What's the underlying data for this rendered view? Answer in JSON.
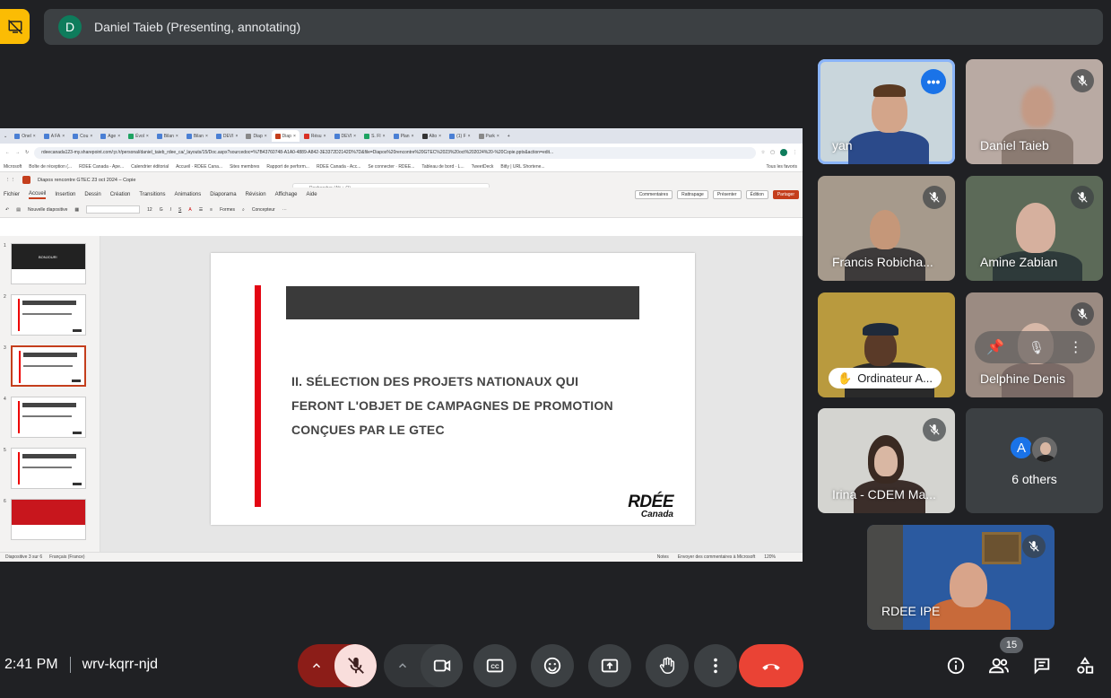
{
  "presenter_bar": {
    "avatar_letter": "D",
    "text": "Daniel Taieb (Presenting, annotating)"
  },
  "shared_screen": {
    "browser_tabs": [
      "Onel",
      "A FA",
      "Cou",
      "Age",
      "Évol",
      "Bilan",
      "Bilan",
      "DEVI",
      "Diap",
      "Diap",
      "Résu",
      "DEVI",
      "S. FI",
      "Plan",
      "Alto",
      "(1) F",
      "Park"
    ],
    "url": "rdeecanada123-my.sharepoint.com/:p:/r/personal/daniel_taieb_rdee_ca/_layouts/15/Doc.aspx?sourcedoc=%7B43760748-A1A0-4889-A842-3E3372D2142D%7D&file=Diapos%20rencontre%20GTEC%2023%20oct%202024%20-%20Copie.pptx&action=edit...",
    "bookmarks": [
      "Microsoft",
      "Boîte de réception (...",
      "RDEE Canada - Ape...",
      "Calendrier éditorial",
      "Accueil · RDEE Cana...",
      "Sites membres",
      "Rapport de perform...",
      "RDEE Canada - Acc...",
      "Se connecter · RDEE...",
      "Tableau de bord · L...",
      "TweetDeck",
      "Bitly | URL Shortene...",
      "Tous les favoris"
    ],
    "doc_title": "Diapos rencontre GTEC 23 oct 2024 – Copie",
    "search_placeholder": "Rechercher (Alt + Q)",
    "ribbon_tabs": [
      "Fichier",
      "Accueil",
      "Insertion",
      "Dessin",
      "Création",
      "Transitions",
      "Animations",
      "Diaporama",
      "Révision",
      "Affichage",
      "Aide"
    ],
    "ribbon_right": {
      "comments": "Commentaires",
      "catchup": "Rattrapage",
      "present": "Présenter",
      "editing": "Édition",
      "share": "Partager"
    },
    "tools": {
      "new_slide": "Nouvelle diapositive",
      "font_size": "12",
      "shapes": "Formes",
      "designer": "Concepteur"
    },
    "thumbnails": [
      {
        "num": "1",
        "label": "BONJOUR!"
      },
      {
        "num": "2",
        "label": ""
      },
      {
        "num": "3",
        "label": ""
      },
      {
        "num": "4",
        "label": ""
      },
      {
        "num": "5",
        "label": ""
      },
      {
        "num": "6",
        "label": ""
      }
    ],
    "slide": {
      "heading": "II. SÉLECTION DES PROJETS NATIONAUX QUI FERONT L'OBJET DE CAMPAGNES DE PROMOTION CONÇUES PAR LE GTEC",
      "logo_main": "RDÉE",
      "logo_sub": "Canada"
    },
    "status": {
      "slide_count": "Diapositive 3 sur 6",
      "language": "Français (France)",
      "notes": "Notes",
      "feedback": "Envoyer des commentaires à Microsoft",
      "zoom": "120%"
    }
  },
  "participants": [
    {
      "name": "yan",
      "muted": false,
      "speaking": true
    },
    {
      "name": "Daniel Taieb",
      "muted": true
    },
    {
      "name": "Francis Robicha...",
      "muted": true
    },
    {
      "name": "Amine Zabian",
      "muted": true
    },
    {
      "name": "Ordinateur A...",
      "muted": false,
      "hand_raised": true
    },
    {
      "name": "Delphine Denis",
      "muted": true
    },
    {
      "name": "Irina - CDEM Ma...",
      "muted": true
    },
    {
      "name": "RDEE IPE",
      "muted": true
    }
  ],
  "others_tile": {
    "avatar_letter": "A",
    "label": "6 others"
  },
  "bottom_bar": {
    "time": "2:41 PM",
    "meeting_code": "wrv-kqrr-njd",
    "participant_count": "15"
  },
  "colors": {
    "background": "#202124",
    "tile": "#3c4043",
    "end_call": "#ea4335",
    "mic_off_bg": "#f9dedc",
    "present_highlight": "#fbbc04"
  }
}
